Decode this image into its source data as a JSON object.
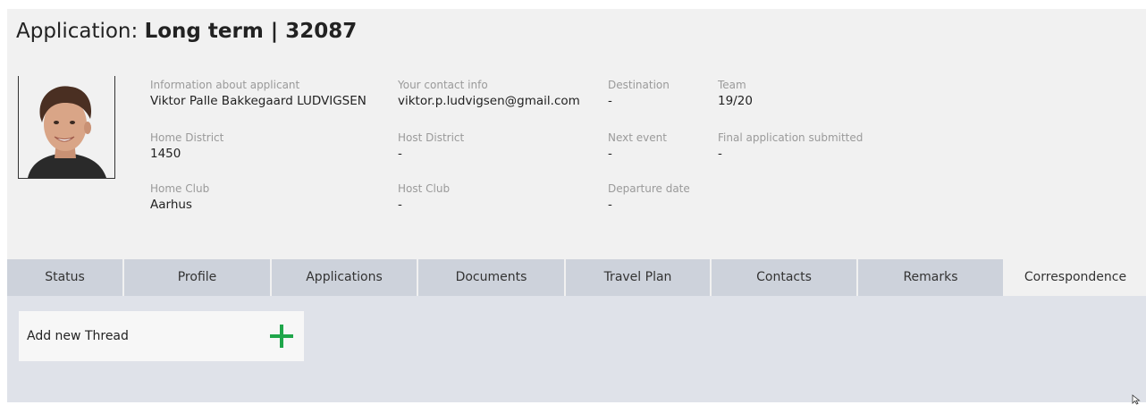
{
  "header": {
    "title_prefix": "Application: ",
    "title_main": "Long term | 32087"
  },
  "applicant": {
    "photo_icon": "applicant-photo",
    "fields": {
      "info": {
        "label": "Information about applicant",
        "value": "Viktor Palle Bakkegaard LUDVIGSEN"
      },
      "contact": {
        "label": "Your contact info",
        "value": "viktor.p.ludvigsen@gmail.com"
      },
      "destination": {
        "label": "Destination",
        "value": "-"
      },
      "team": {
        "label": "Team",
        "value": "19/20"
      },
      "home_district": {
        "label": "Home District",
        "value": "1450"
      },
      "host_district": {
        "label": "Host District",
        "value": "-"
      },
      "next_event": {
        "label": "Next event",
        "value": "-"
      },
      "final_app": {
        "label": "Final application submitted",
        "value": "-"
      },
      "home_club": {
        "label": "Home Club",
        "value": "Aarhus"
      },
      "host_club": {
        "label": "Host Club",
        "value": "-"
      },
      "departure": {
        "label": "Departure date",
        "value": "-"
      }
    }
  },
  "tabs": [
    {
      "label": "Status",
      "active": false
    },
    {
      "label": "Profile",
      "active": false
    },
    {
      "label": "Applications",
      "active": false
    },
    {
      "label": "Documents",
      "active": false
    },
    {
      "label": "Travel Plan",
      "active": false
    },
    {
      "label": "Contacts",
      "active": false
    },
    {
      "label": "Remarks",
      "active": false
    },
    {
      "label": "Correspondence",
      "active": true
    }
  ],
  "correspondence": {
    "add_thread_label": "Add new Thread",
    "add_icon": "plus-icon"
  },
  "colors": {
    "panel_bg": "#f1f1f1",
    "tab_bg": "#cdd2db",
    "content_bg": "#dfe2e9",
    "accent_green": "#1fa64a"
  }
}
